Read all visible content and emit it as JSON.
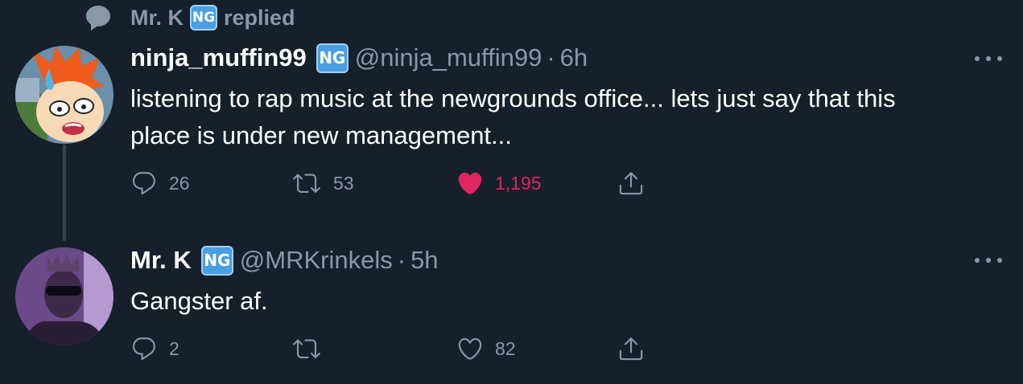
{
  "context": {
    "name": "Mr. K",
    "badge": "NG",
    "action": "replied"
  },
  "tweets": [
    {
      "display_name": "ninja_muffin99",
      "badge": "NG",
      "handle": "@ninja_muffin99",
      "time": "6h",
      "text_lines": [
        "listening to rap music at the newgrounds office... lets just say that this",
        "place is under new management..."
      ],
      "replies": "26",
      "retweets": "53",
      "likes": "1,195",
      "liked": true
    },
    {
      "display_name": "Mr. K",
      "badge": "NG",
      "handle": "@MRKrinkels",
      "time": "5h",
      "text_lines": [
        "Gangster af."
      ],
      "replies": "2",
      "retweets": "",
      "likes": "82",
      "liked": false
    }
  ],
  "separator": "·",
  "colors": {
    "background": "#15202b",
    "secondary_text": "#8899a6",
    "like_pink": "#e0245e",
    "ng_blue": "#4a9fe0"
  }
}
